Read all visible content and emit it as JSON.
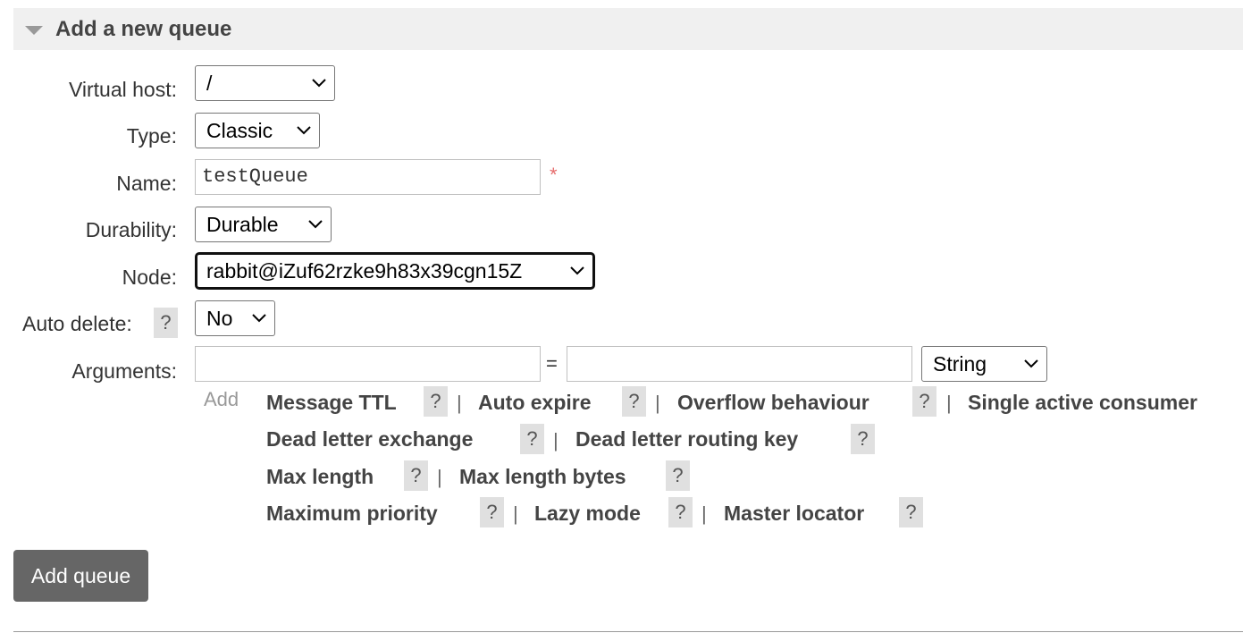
{
  "section": {
    "title": "Add a new queue"
  },
  "form": {
    "virtual_host": {
      "label": "Virtual host:",
      "value": "/"
    },
    "type": {
      "label": "Type:",
      "value": "Classic"
    },
    "name": {
      "label": "Name:",
      "value": "testQueue",
      "required_mark": "*"
    },
    "durability": {
      "label": "Durability:",
      "value": "Durable"
    },
    "node": {
      "label": "Node:",
      "value": "rabbit@iZuf62rzke9h83x39cgn15Z"
    },
    "auto_delete": {
      "label": "Auto delete:",
      "help": "?",
      "value": "No"
    },
    "arguments": {
      "label": "Arguments:",
      "key_value": "",
      "equals": "=",
      "value_value": "",
      "type_value": "String",
      "add_label": "Add",
      "separator": "|",
      "help": "?",
      "links": [
        "Message TTL",
        "Auto expire",
        "Overflow behaviour",
        "Single active consumer",
        "Dead letter exchange",
        "Dead letter routing key",
        "Max length",
        "Max length bytes",
        "Maximum priority",
        "Lazy mode",
        "Master locator"
      ]
    }
  },
  "actions": {
    "add_queue": "Add queue"
  }
}
